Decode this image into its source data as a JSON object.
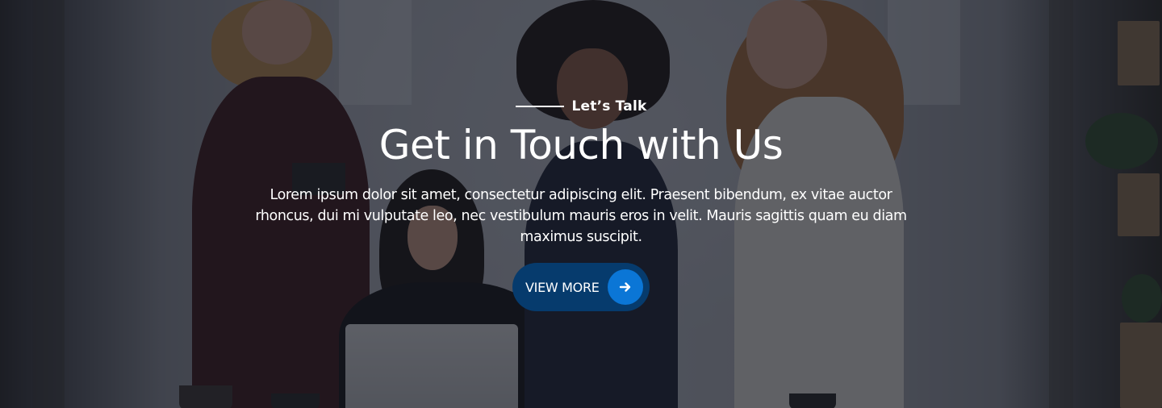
{
  "hero": {
    "eyebrow": "Let’s Talk",
    "title": "Get in Touch with Us",
    "description": "Lorem ipsum dolor sit amet, consectetur adipiscing elit. Praesent bibendum, ex vitae auctor rhoncus, dui mi vulputate leo, nec vestibulum mauris eros in velit. Mauris sagittis quam eu diam maximus suscipit.",
    "cta_label": "VIEW MORE",
    "cta_icon": "arrow-right-icon"
  },
  "colors": {
    "overlay": "#14161f",
    "cta_background": "#063b6d",
    "cta_icon_background": "#0b76d6",
    "text": "#ffffff"
  }
}
